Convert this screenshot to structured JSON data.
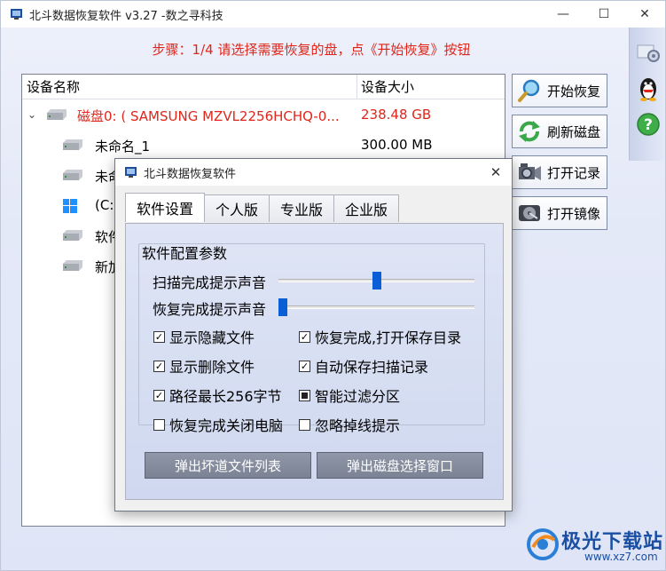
{
  "window": {
    "title": "北斗数据恢复软件 v3.27 -数之寻科技",
    "minimize": "—",
    "maximize": "☐",
    "close": "✕"
  },
  "step_text": "步骤：1/4 请选择需要恢复的盘，点《开始恢复》按钮",
  "device_list": {
    "headers": {
      "name": "设备名称",
      "size": "设备大小"
    },
    "rows": [
      {
        "name": "磁盘0: ( SAMSUNG MZVL2256HCHQ-0...",
        "size": "238.48 GB",
        "expander": "⌄"
      },
      {
        "name": "未命名_1",
        "size": "300.00 MB"
      },
      {
        "name": "未命",
        "size": ""
      },
      {
        "name": "(C:)",
        "size": ""
      },
      {
        "name": "软件",
        "size": ""
      },
      {
        "name": "新加",
        "size": ""
      }
    ]
  },
  "side_buttons": {
    "start": "开始恢复",
    "refresh": "刷新磁盘",
    "open_record": "打开记录",
    "open_image": "打开镜像"
  },
  "dialog": {
    "title": "北斗数据恢复软件",
    "close": "✕",
    "tabs": [
      "软件设置",
      "个人版",
      "专业版",
      "企业版"
    ],
    "group_title": "软件配置参数",
    "sliders": [
      {
        "label": "扫描完成提示声音",
        "level": 0.5
      },
      {
        "label": "恢复完成提示声音",
        "level": 0.0
      }
    ],
    "checkboxes": {
      "show_hidden": {
        "label": "显示隐藏文件",
        "state": "checked"
      },
      "open_dir": {
        "label": "恢复完成,打开保存目录",
        "state": "checked"
      },
      "show_deleted": {
        "label": "显示删除文件",
        "state": "checked"
      },
      "auto_save": {
        "label": "自动保存扫描记录",
        "state": "checked"
      },
      "path_256": {
        "label": "路径最长256字节",
        "state": "checked"
      },
      "smart_filter": {
        "label": "智能过滤分区",
        "state": "indeterminate"
      },
      "shutdown": {
        "label": "恢复完成关闭电脑",
        "state": "unchecked"
      },
      "ignore_drop": {
        "label": "忽略掉线提示",
        "state": "unchecked"
      }
    },
    "buttons": {
      "bad_sectors": "弹出坏道文件列表",
      "disk_select": "弹出磁盘选择窗口"
    }
  },
  "watermark": {
    "text": "极光下载站",
    "url": "www.xz7.com"
  },
  "colors": {
    "accent_red": "#e0261b",
    "slider_blue": "#0a5fd6"
  }
}
